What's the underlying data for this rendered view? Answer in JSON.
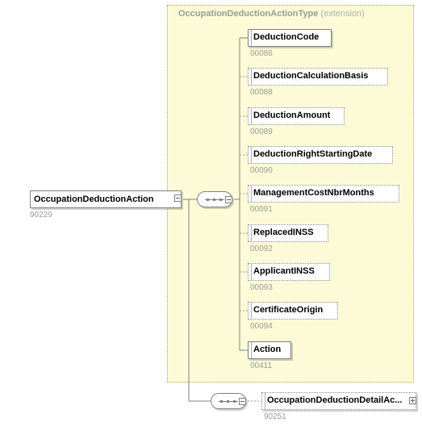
{
  "extension": {
    "name": "OccupationDeductionActionType",
    "suffix": "(extension)"
  },
  "root": {
    "label": "OccupationDeductionAction",
    "code": "90229"
  },
  "children": [
    {
      "label": "DeductionCode",
      "code": "00086",
      "optional": false
    },
    {
      "label": "DeductionCalculationBasis",
      "code": "00088",
      "optional": true
    },
    {
      "label": "DeductionAmount",
      "code": "00089",
      "optional": true
    },
    {
      "label": "DeductionRightStartingDate",
      "code": "00090",
      "optional": true
    },
    {
      "label": "ManagementCostNbrMonths",
      "code": "00091",
      "optional": true
    },
    {
      "label": "ReplacedINSS",
      "code": "00092",
      "optional": true
    },
    {
      "label": "ApplicantINSS",
      "code": "00093",
      "optional": true
    },
    {
      "label": "CertificateOrigin",
      "code": "00094",
      "optional": true
    },
    {
      "label": "Action",
      "code": "00411",
      "optional": false
    }
  ],
  "detail": {
    "label": "OccupationDeductionDetailAc...",
    "code": "90251"
  }
}
